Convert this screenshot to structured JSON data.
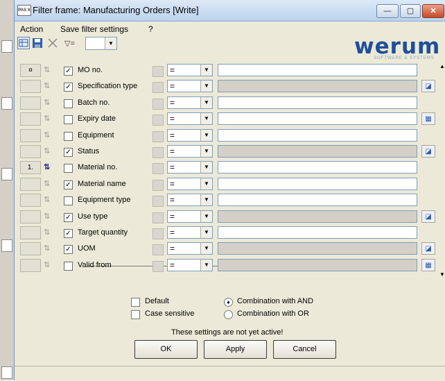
{
  "window": {
    "title": "Filter frame: Manufacturing Orders [Write]",
    "app_icon_text": "PAS X"
  },
  "title_buttons": {
    "minimize": "—",
    "maximize": "▢",
    "close": "✕"
  },
  "menu": {
    "items": [
      "Action",
      "Save filter settings",
      "?"
    ]
  },
  "toolbar": {
    "filter_icon_label": "▽=",
    "filter_select_value": ""
  },
  "logo": {
    "word": "werum",
    "subtitle": "SOFTWARE & SYSTEMS"
  },
  "rows": [
    {
      "button": "¤",
      "checked": true,
      "label": "MO no.",
      "op": "=",
      "disabled": false,
      "side_button": ""
    },
    {
      "button": "",
      "checked": true,
      "label": "Specification type",
      "op": "=",
      "disabled": true,
      "side_button": "lookup"
    },
    {
      "button": "",
      "checked": false,
      "label": "Batch no.",
      "op": "=",
      "disabled": false,
      "side_button": ""
    },
    {
      "button": "",
      "checked": false,
      "label": "Expiry date",
      "op": "=",
      "disabled": false,
      "side_button": "calendar"
    },
    {
      "button": "",
      "checked": false,
      "label": "Equipment",
      "op": "=",
      "disabled": false,
      "side_button": ""
    },
    {
      "button": "",
      "checked": true,
      "label": "Status",
      "op": "=",
      "disabled": true,
      "side_button": "lookup"
    },
    {
      "button": "1.",
      "checked": false,
      "label": "Material no.",
      "op": "=",
      "disabled": false,
      "side_button": "",
      "sort_active": true
    },
    {
      "button": "",
      "checked": true,
      "label": "Material name",
      "op": "=",
      "disabled": false,
      "side_button": ""
    },
    {
      "button": "",
      "checked": false,
      "label": "Equipment type",
      "op": "=",
      "disabled": false,
      "side_button": ""
    },
    {
      "button": "",
      "checked": true,
      "label": "Use type",
      "op": "=",
      "disabled": true,
      "side_button": "lookup"
    },
    {
      "button": "",
      "checked": true,
      "label": "Target quantity",
      "op": "=",
      "disabled": false,
      "side_button": ""
    },
    {
      "button": "",
      "checked": true,
      "label": "UOM",
      "op": "=",
      "disabled": true,
      "side_button": "lookup"
    },
    {
      "button": "",
      "checked": false,
      "label": "Valid from",
      "op": "=",
      "disabled": true,
      "side_button": "calendar"
    }
  ],
  "options": {
    "default_label": "Default",
    "case_sensitive_label": "Case sensitive",
    "and_label": "Combination with AND",
    "or_label": "Combination with OR",
    "default_checked": false,
    "case_sensitive_checked": false,
    "combination": "AND"
  },
  "notice": "These settings are not yet active!",
  "buttons": {
    "ok": "OK",
    "apply": "Apply",
    "cancel": "Cancel"
  },
  "colors": {
    "logo": "#1f4f9a",
    "field_border": "#7f9db9",
    "disabled_field": "#d4d0c8"
  }
}
